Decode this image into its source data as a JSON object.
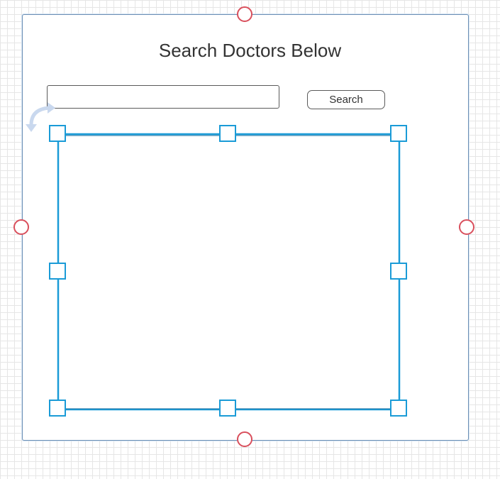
{
  "canvas": {
    "background": "#ffffff",
    "grid_color": "#e6e6e6"
  },
  "mockup": {
    "title": "Search Doctors Below",
    "search_input": {
      "value": "",
      "placeholder": ""
    },
    "search_button_label": "Search"
  },
  "selection": {
    "selected_element": "results-box",
    "accent_color": "#1a9bd7",
    "connector_color": "#d94f5c",
    "handle_icon": "square-resize-handle",
    "connector_icon": "circle-connection-point",
    "rotate_icon": "rotate-arrow-icon"
  }
}
